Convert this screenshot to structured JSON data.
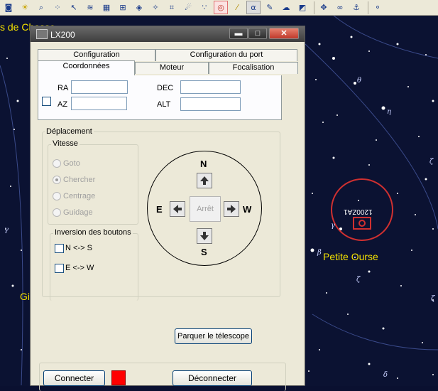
{
  "toolbar": {
    "icons": [
      "camera-icon",
      "bulb-icon",
      "telescope-icon",
      "stars-icon",
      "pointer-icon",
      "milkyway-icon",
      "grid-icon",
      "eq-grid-icon",
      "compass-icon",
      "constellation-icon",
      "frame-icon",
      "comet-icon",
      "dots-icon",
      "target-icon",
      "ruler-icon",
      "alpha-icon",
      "labels-icon",
      "cloud-icon",
      "dark-icon",
      "move-icon",
      "link-icon",
      "anchor-icon",
      "planets-icon"
    ],
    "alpha_label": "α"
  },
  "map": {
    "label_chasse": "s de Chasse",
    "label_petite_ourse": "Petite Ourse",
    "label_gi": "Gi",
    "telescope_marker": "1200ZA1"
  },
  "window": {
    "title": "LX200",
    "minimize": "▬",
    "maximize": "□",
    "close": "✕",
    "tabs_row1": [
      "Configuration",
      "Configuration du port"
    ],
    "tabs_row2": [
      "Coordonnées",
      "Moteur",
      "Focalisation"
    ],
    "coords": {
      "ra_label": "RA",
      "dec_label": "DEC",
      "az_label": "AZ",
      "alt_label": "ALT",
      "ra_value": "",
      "dec_value": "",
      "az_value": "",
      "alt_value": ""
    },
    "movement": {
      "title": "Déplacement",
      "speed_title": "Vitesse",
      "speeds": [
        "Goto",
        "Chercher",
        "Centrage",
        "Guidage"
      ],
      "selected_speed": "Chercher",
      "inversion_title": "Inversion des boutons",
      "inversions": [
        "N <-> S",
        "E <-> W"
      ],
      "north": "N",
      "south": "S",
      "east": "E",
      "west": "W",
      "stop": "Arrêt"
    },
    "park_button": "Parquer le télescope",
    "connect_button": "Connecter",
    "disconnect_button": "Déconnecter",
    "status_color": "#ff0000"
  }
}
